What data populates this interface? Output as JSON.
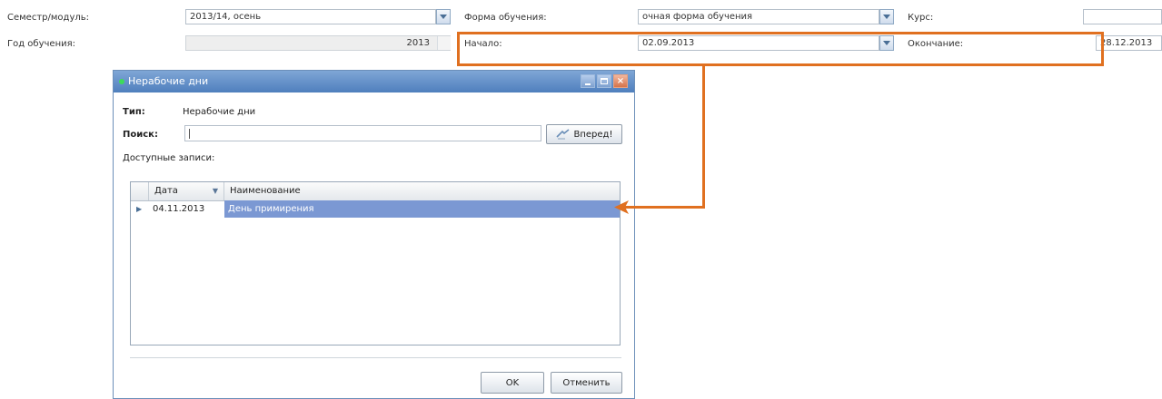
{
  "form": {
    "semester_label": "Семестр/модуль:",
    "semester_value": "2013/14, осень",
    "form_label": "Форма обучения:",
    "form_value": "очная форма обучения",
    "course_label": "Курс:",
    "course_value": "",
    "year_label": "Год обучения:",
    "year_value": "2013",
    "start_label": "Начало:",
    "start_value": "02.09.2013",
    "end_label": "Окончание:",
    "end_value": "28.12.2013"
  },
  "dialog": {
    "title": "Нерабочие дни",
    "type_label": "Тип:",
    "type_value": "Нерабочие дни",
    "search_label": "Поиск:",
    "search_value": "",
    "search_button": "Вперед!",
    "available_label": "Доступные записи:",
    "columns": [
      "Дата",
      "Наименование"
    ],
    "rows": [
      {
        "date": "04.11.2013",
        "name": "День примирения"
      }
    ],
    "ok_button": "OK",
    "cancel_button": "Отменить"
  },
  "colors": {
    "annotation": "#e07020",
    "selected_row": "#7b98d3",
    "titlebar": "#5f8cc6"
  }
}
